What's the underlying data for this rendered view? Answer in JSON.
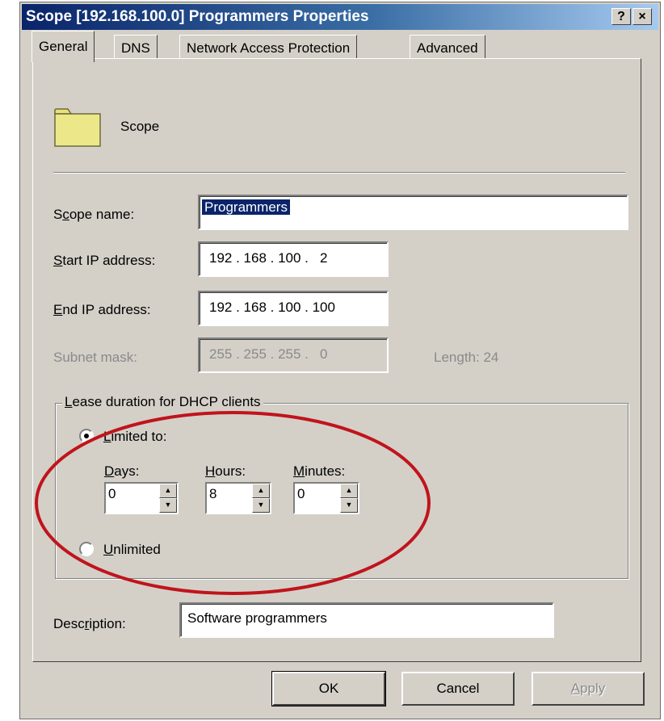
{
  "window": {
    "title": "Scope [192.168.100.0] Programmers Properties",
    "help_button": "?",
    "close_button": "×"
  },
  "tabs": [
    {
      "label": "General",
      "active": true
    },
    {
      "label": "DNS",
      "active": false
    },
    {
      "label": "Network Access Protection",
      "active": false
    },
    {
      "label": "Advanced",
      "active": false
    }
  ],
  "header": {
    "icon": "folder-icon",
    "caption": "Scope"
  },
  "form": {
    "scope_name": {
      "label_pre": "S",
      "label_u": "c",
      "label_post": "ope name:",
      "value": "Programmers"
    },
    "start_ip": {
      "label_u": "S",
      "label_post": "tart IP address:",
      "value": "192 . 168 . 100 .   2"
    },
    "end_ip": {
      "label_u": "E",
      "label_post": "nd IP address:",
      "value": "192 . 168 . 100 . 100"
    },
    "subnet_mask": {
      "label": "Subnet mask:",
      "value": "255 . 255 . 255 .   0"
    },
    "length": {
      "label": "Length:",
      "value": "24"
    }
  },
  "lease": {
    "legend_u": "L",
    "legend_post": "ease duration for DHCP clients",
    "limited": {
      "label_u": "L",
      "label_post": "imited to:",
      "selected": true
    },
    "days": {
      "label_u": "D",
      "label_post": "ays:",
      "value": "0"
    },
    "hours": {
      "label_u": "H",
      "label_post": "ours:",
      "value": "8"
    },
    "minutes": {
      "label_u": "M",
      "label_post": "inutes:",
      "value": "0"
    },
    "unlimited": {
      "label_u": "U",
      "label_post": "nlimited",
      "selected": false
    }
  },
  "description": {
    "label_pre": "Desc",
    "label_u": "r",
    "label_post": "iption:",
    "value": "Software programmers"
  },
  "buttons": {
    "ok": "OK",
    "cancel": "Cancel",
    "apply_u": "A",
    "apply_post": "pply"
  },
  "colors": {
    "titlebar_start": "#0a246a",
    "titlebar_end": "#a6caf0",
    "dialog_face": "#d4d0c8",
    "annotation_ellipse": "#c0141c"
  }
}
